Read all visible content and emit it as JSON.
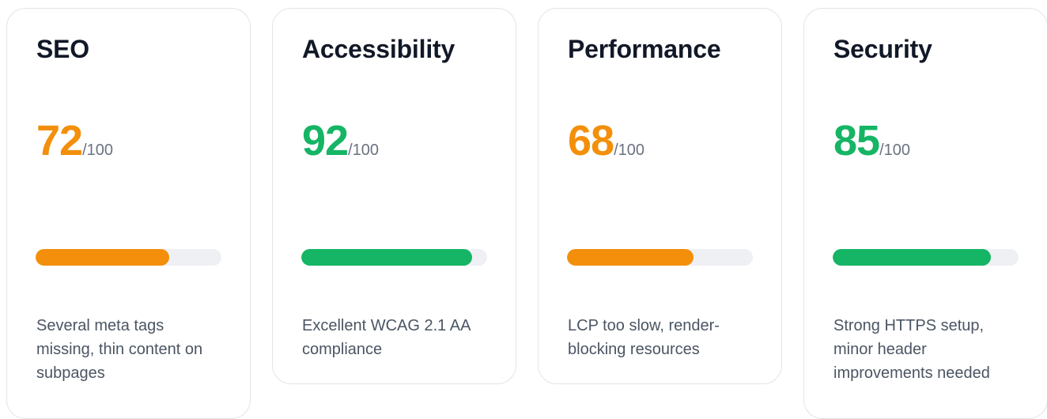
{
  "colors": {
    "warning": "#f38f0b",
    "good": "#15b565",
    "track": "#eef0f4"
  },
  "cards": [
    {
      "title": "SEO",
      "score": "72",
      "max": "/100",
      "fraction": 0.72,
      "status": "warning",
      "description": "Several meta tags missing, thin content on subpages"
    },
    {
      "title": "Accessibility",
      "score": "92",
      "max": "/100",
      "fraction": 0.92,
      "status": "good",
      "description": "Excellent WCAG 2.1 AA compliance"
    },
    {
      "title": "Performance",
      "score": "68",
      "max": "/100",
      "fraction": 0.68,
      "status": "warning",
      "description": "LCP too slow, render-blocking resources"
    },
    {
      "title": "Security",
      "score": "85",
      "max": "/100",
      "fraction": 0.85,
      "status": "good",
      "description": "Strong HTTPS setup, minor header improvements needed"
    }
  ]
}
